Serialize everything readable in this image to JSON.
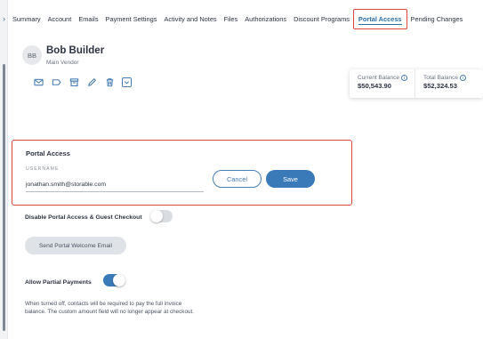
{
  "tabs": [
    {
      "label": "Summary"
    },
    {
      "label": "Account"
    },
    {
      "label": "Emails"
    },
    {
      "label": "Payment Settings"
    },
    {
      "label": "Activity and Notes"
    },
    {
      "label": "Files"
    },
    {
      "label": "Authorizations"
    },
    {
      "label": "Discount Programs"
    },
    {
      "label": "Portal Access",
      "active": true
    },
    {
      "label": "Pending Changes"
    }
  ],
  "rail": {
    "toggle_glyph": "›"
  },
  "vendor": {
    "initials": "BB",
    "name": "Bob Builder",
    "role": "Main Vendor"
  },
  "actions": [
    "mail-icon",
    "tag-icon",
    "archive-icon",
    "pencil-icon",
    "trash-icon",
    "chevron-down-icon"
  ],
  "balances": {
    "current_label": "Current Balance",
    "current_value": "$50,543.90",
    "total_label": "Total Balance",
    "total_value": "$52,324.53",
    "info_glyph": "i"
  },
  "portal": {
    "title": "Portal Access",
    "username_label": "USERNAME",
    "username_value": "jonathan.smith@storable.com",
    "cancel_label": "Cancel",
    "save_label": "Save"
  },
  "settings": {
    "disable_label": "Disable Portal Access & Guest Checkout",
    "disable_on": false,
    "welcome_label": "Send Portal Welcome Email",
    "partial_label": "Allow Partial Payments",
    "partial_on": true,
    "partial_help": "When turned off, contacts will be required to pay the full invoice balance. The custom amount field will no longer appear at checkout."
  },
  "colors": {
    "accent": "#3a7ab8",
    "highlight_border": "#e2463c",
    "text": "#2d3340"
  }
}
